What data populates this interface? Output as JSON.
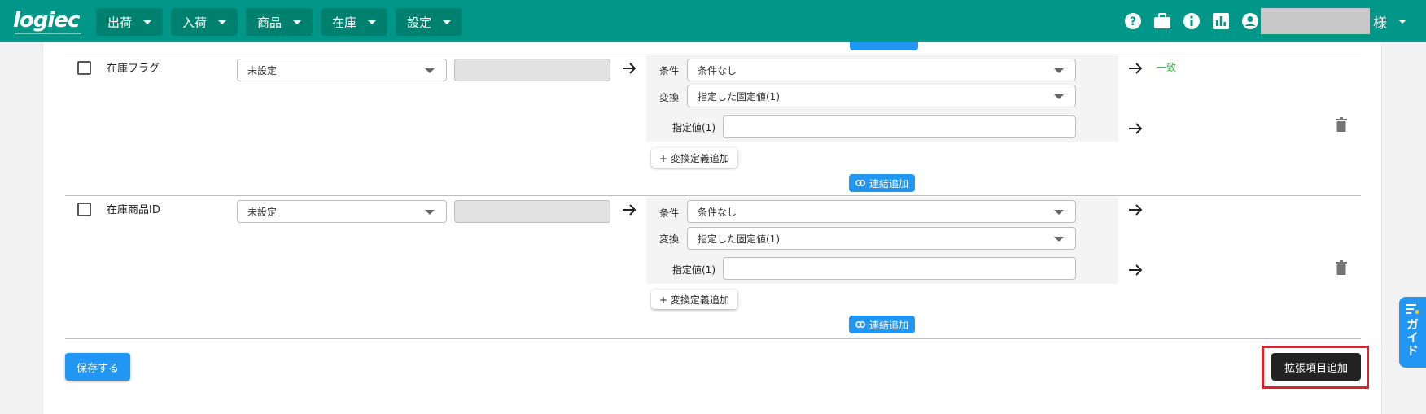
{
  "header": {
    "logo_text": "logiec",
    "nav": [
      {
        "label": "出荷"
      },
      {
        "label": "入荷"
      },
      {
        "label": "商品"
      },
      {
        "label": "在庫"
      },
      {
        "label": "設定"
      }
    ],
    "icons": [
      "help-icon",
      "briefcase-icon",
      "info-icon",
      "bar-chart-icon",
      "account-circle-icon"
    ],
    "user_suffix": "様",
    "color": "#009688"
  },
  "rows": [
    {
      "field_label": "在庫フラグ",
      "mapping_select": "未設定",
      "condition_label": "条件",
      "condition_value": "条件なし",
      "conversion_label": "変換",
      "conversion_value": "指定した固定値(1)",
      "fixed_value_label": "指定値(1)",
      "fixed_value": "",
      "result_text": "一致",
      "add_conversion_label": "+ 変換定義追加",
      "link_add_label": "連結追加"
    },
    {
      "field_label": "在庫商品ID",
      "mapping_select": "未設定",
      "condition_label": "条件",
      "condition_value": "条件なし",
      "conversion_label": "変換",
      "conversion_value": "指定した固定値(1)",
      "fixed_value_label": "指定値(1)",
      "fixed_value": "",
      "result_text": "",
      "add_conversion_label": "+ 変換定義追加",
      "link_add_label": "連結追加"
    }
  ],
  "footer": {
    "save_label": "保存する",
    "extend_label": "拡張項目追加"
  },
  "guide": {
    "label": "ガイド"
  },
  "colors": {
    "primary": "#2196f3",
    "match": "#4caf50",
    "highlight": "#e0202a"
  }
}
